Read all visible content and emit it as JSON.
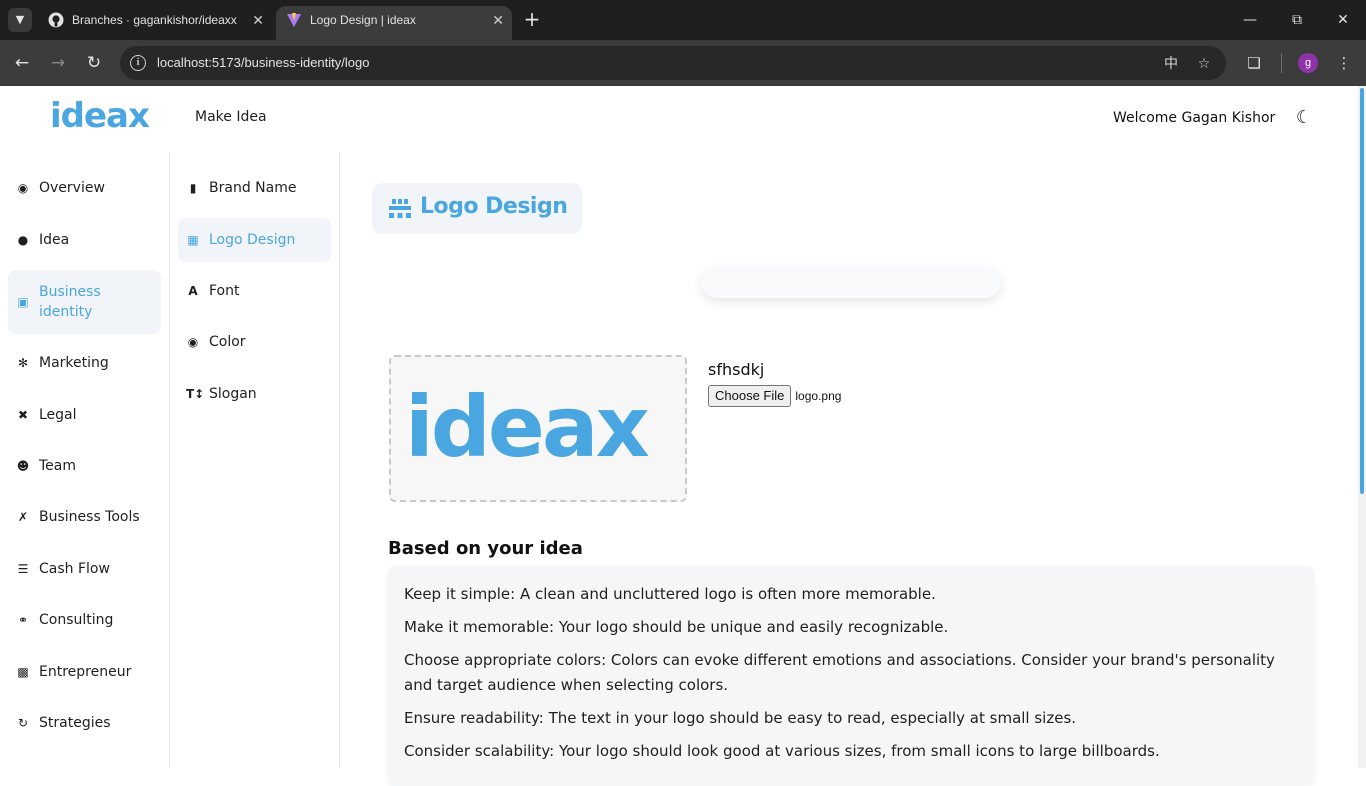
{
  "browser": {
    "tabs": [
      {
        "title": "Branches · gagankishor/ideaxx",
        "favicon": "github-icon",
        "active": false
      },
      {
        "title": "Logo Design | ideax",
        "favicon": "vite-icon",
        "active": true
      }
    ],
    "url": "localhost:5173/business-identity/logo"
  },
  "header": {
    "logo": "ideax",
    "make_idea": "Make Idea",
    "welcome": "Welcome Gagan Kishor",
    "theme_icon": "moon-icon"
  },
  "sidebar": {
    "items": [
      {
        "label": "Overview",
        "icon": "eye-icon"
      },
      {
        "label": "Idea",
        "icon": "lightbulb-icon"
      },
      {
        "label": "Business identity",
        "icon": "business-identity-icon",
        "active": true
      },
      {
        "label": "Marketing",
        "icon": "compass-icon"
      },
      {
        "label": "Legal",
        "icon": "scale-icon"
      },
      {
        "label": "Team",
        "icon": "team-icon"
      },
      {
        "label": "Business Tools",
        "icon": "tools-icon"
      },
      {
        "label": "Cash Flow",
        "icon": "coins-icon"
      },
      {
        "label": "Consulting",
        "icon": "handshake-icon"
      },
      {
        "label": "Entrepreneur",
        "icon": "entrepreneur-icon"
      },
      {
        "label": "Strategies",
        "icon": "strategy-icon"
      }
    ]
  },
  "subnav": {
    "items": [
      {
        "label": "Brand Name",
        "icon": "book-icon"
      },
      {
        "label": "Logo Design",
        "icon": "pallet-icon",
        "active": true
      },
      {
        "label": "Font",
        "icon": "font-icon"
      },
      {
        "label": "Color",
        "icon": "palette-icon"
      },
      {
        "label": "Slogan",
        "icon": "text-height-icon"
      }
    ]
  },
  "main": {
    "title": "Logo Design",
    "logo_preview_text": "ideax",
    "logo_name": "sfhsdkj",
    "file_button": "Choose File",
    "file_name": "logo.png",
    "based_title": "Based on your idea",
    "tips": [
      "Keep it simple: A clean and uncluttered logo is often more memorable.",
      "Make it memorable: Your logo should be unique and easily recognizable.",
      "Choose appropriate colors: Colors can evoke different emotions and associations. Consider your brand's personality and target audience when selecting colors.",
      "Ensure readability: The text in your logo should be easy to read, especially at small sizes.",
      "Consider scalability: Your logo should look good at various sizes, from small icons to large billboards."
    ]
  },
  "colors": {
    "accent": "#4aa6e0",
    "active_bg": "#f1f5f9",
    "chrome_dark": "#1f1f1f"
  }
}
